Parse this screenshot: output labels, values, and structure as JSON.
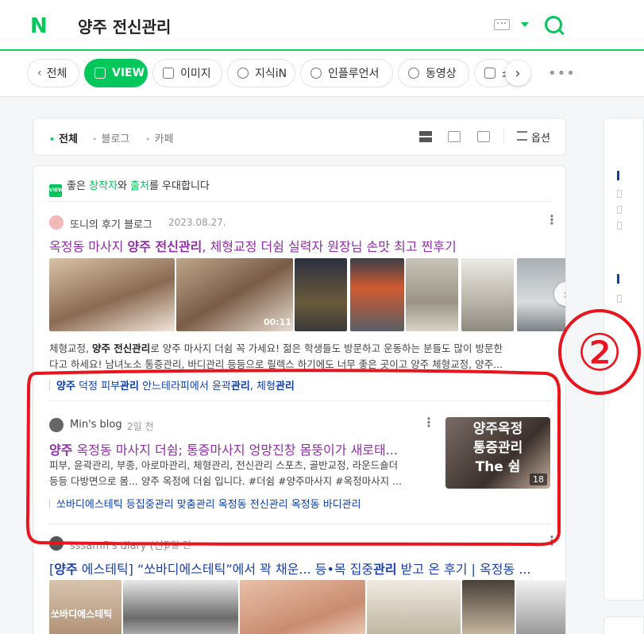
{
  "header": {
    "logo": "N",
    "query": "양주 전신관리"
  },
  "tabs": [
    {
      "label": "전체"
    },
    {
      "label": "VIEW"
    },
    {
      "label": "이미지"
    },
    {
      "label": "지식iN"
    },
    {
      "label": "인플루언서"
    },
    {
      "label": "동영상"
    },
    {
      "label": "쇼"
    }
  ],
  "filter": {
    "items": [
      "전체",
      "블로그",
      "카페"
    ],
    "options_label": "옵션"
  },
  "notice": {
    "badge": "VIEW",
    "p1": "좋은 ",
    "creator": "창작자",
    "p2": "와 ",
    "source": "출처",
    "p3": "를 우대합니다"
  },
  "results": [
    {
      "author": "또니의 후기 블로그",
      "date": "2023.08.27.",
      "title_a": "옥정동 마사지 ",
      "title_b": "양주 전신관리",
      "title_c": ", 체형교정 더쉼 실력자 원장님 손맛 최고 찐후기",
      "video_duration": "00:11",
      "desc_line1_a": "체형교정, ",
      "desc_line1_b": "양주 전신관리",
      "desc_line1_c": "로 양주 마사지 더쉼 꼭 가세요! 젊은 학생들도 방문하고 운동하는 분들도 많이 방문한",
      "desc_line2": "다고 하세요! 남녀노소 통증관리, 바디관리 등등으로 릴렉스 하기에도 너무 좋은 곳이고 양주 체형교정, 양주...",
      "tag_a": "양주",
      "tag_b": " 덕정 피부",
      "tag_c": "관리",
      "tag_d": " 안느테라피에서 윤곽",
      "tag_e": "관리",
      "tag_f": ", 체형",
      "tag_g": "관리"
    },
    {
      "author": "Min's blog",
      "date": "2일 전",
      "title_a": "양주",
      "title_b": " 옥정동 마사지 더쉼; 통증마사지 엉망진창 몸뚱이가 새로태...",
      "desc_line1": "피부, 윤곽관리, 부종, 아로마관리, 체형관리, 전신관리 스포츠, 골반교정, 라운드숄더",
      "desc_line2": "등등 다방면으로 몸... 양주 옥정에 더쉼 입니다. #더쉼 #양주마사지 #옥정마사지 ...",
      "tags": "쏘바디에스테틱 등집중관리 맞춤관리 옥정동 전신관리 옥정동 바디관리",
      "thumb_line1": "양주옥정",
      "thumb_line2": "통증관리",
      "thumb_line3": "The 쉼",
      "thumb_count": "18"
    },
    {
      "author": "sssamfl's diary (신)",
      "date": "5일 전",
      "title_a": "[",
      "title_b": "양주",
      "title_c": " 에스테틱] “쏘바디에스테틱”에서 꽉 채운... 등•목 집중",
      "title_d": "관리",
      "title_e": " 받고 온 후기 | 옥정동 ...",
      "img_text": "쏘바디에스테틱"
    }
  ],
  "annotation": {
    "label": "②",
    "color": "#e8141e"
  }
}
